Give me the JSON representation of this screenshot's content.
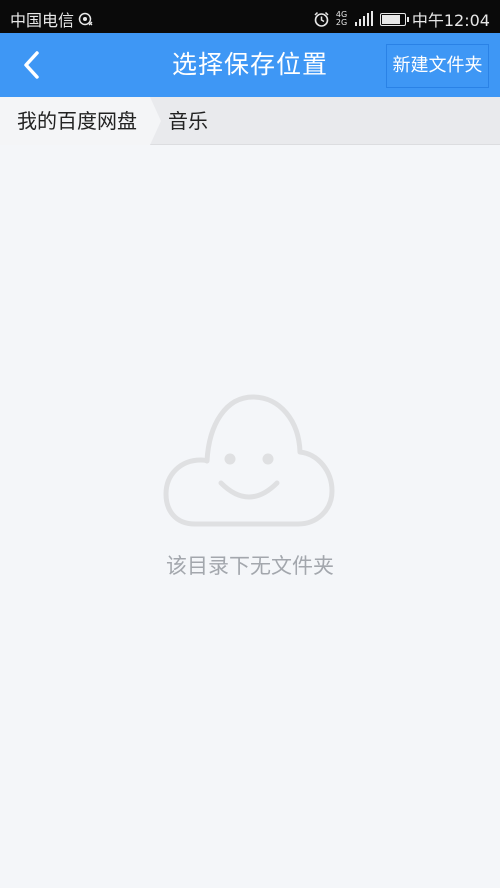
{
  "status_bar": {
    "carrier": "中国电信",
    "network_tag_top": "4G",
    "network_tag_bottom": "2G",
    "battery_level": 0.85,
    "time": "中午12:04"
  },
  "header": {
    "title": "选择保存位置",
    "new_folder_label": "新建文件夹",
    "accent_color": "#3e97f5"
  },
  "breadcrumb": {
    "root": "我的百度网盘",
    "current": "音乐"
  },
  "empty_state": {
    "message": "该目录下无文件夹",
    "icon": "cloud-smile-icon"
  }
}
